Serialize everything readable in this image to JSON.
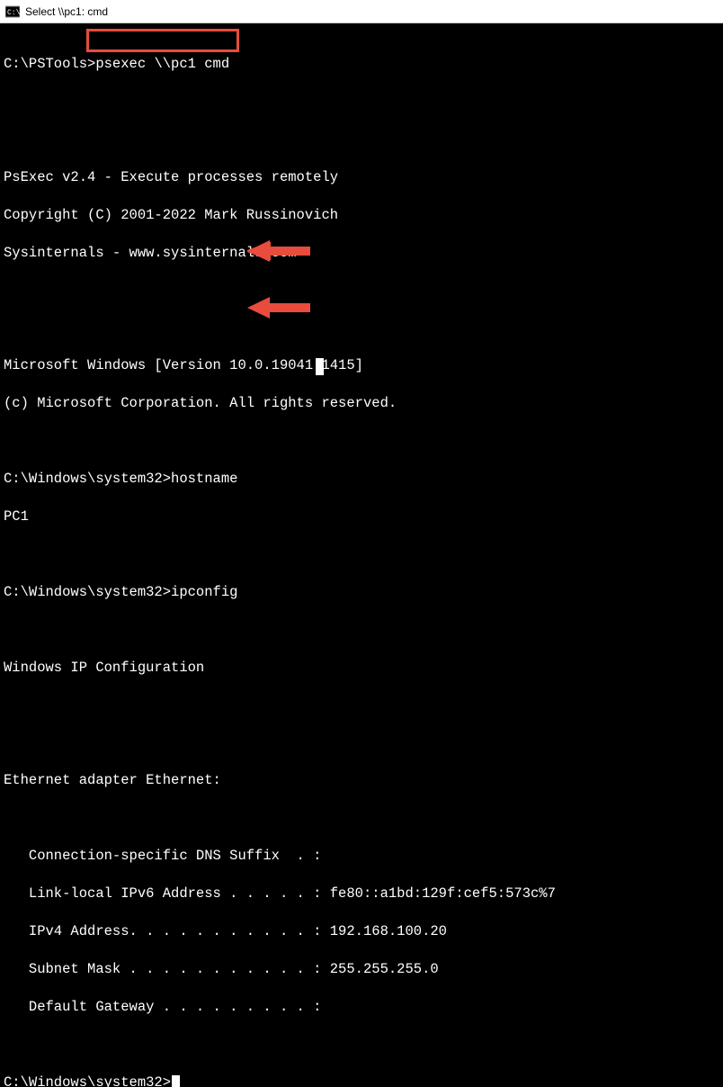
{
  "titlebar": {
    "text": "Select \\\\pc1: cmd"
  },
  "terminal": {
    "prompt1_path": "C:\\PSTools>",
    "prompt1_cmd": "psexec \\\\pc1 cmd",
    "psexec_line1": "PsExec v2.4 - Execute processes remotely",
    "psexec_line2": "Copyright (C) 2001-2022 Mark Russinovich",
    "psexec_line3": "Sysinternals - www.sysinternals.com",
    "win_line1": "Microsoft Windows [Version 10.0.19041.1415]",
    "win_line2": "(c) Microsoft Corporation. All rights reserved.",
    "prompt2_path": "C:\\Windows\\system32>",
    "prompt2_cmd": "hostname",
    "hostname_output": "PC1",
    "prompt3_path": "C:\\Windows\\system32>",
    "prompt3_cmd": "ipconfig",
    "ipconfig_header": "Windows IP Configuration",
    "adapter_header": "Ethernet adapter Ethernet:",
    "dns_suffix": "   Connection-specific DNS Suffix  . :",
    "ipv6": "   Link-local IPv6 Address . . . . . : fe80::a1bd:129f:cef5:573c%7",
    "ipv4": "   IPv4 Address. . . . . . . . . . . : 192.168.100.20",
    "subnet": "   Subnet Mask . . . . . . . . . . . : 255.255.255.0",
    "gateway": "   Default Gateway . . . . . . . . . :",
    "prompt4_path": "C:\\Windows\\system32>"
  }
}
